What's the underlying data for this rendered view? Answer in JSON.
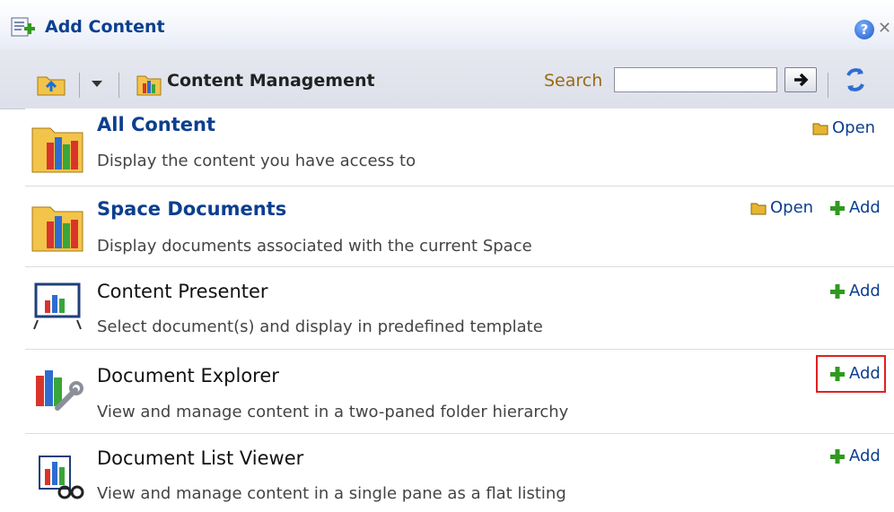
{
  "dialog": {
    "title": "Add Content",
    "help_icon": "help-icon",
    "close_icon": "close-icon"
  },
  "toolbar": {
    "location": "Content Management",
    "search_label": "Search",
    "search_value": "",
    "search_placeholder": ""
  },
  "items": [
    {
      "name": "All Content",
      "description": "Display the content you have access to",
      "icon": "library-folder-icon",
      "actions": [
        "Open"
      ]
    },
    {
      "name": "Space Documents",
      "description": "Display documents associated with the current Space",
      "icon": "library-folder-icon",
      "actions": [
        "Open",
        "Add"
      ]
    },
    {
      "name": "Content Presenter",
      "description": "Select document(s) and display in predefined template",
      "icon": "presentation-board-icon",
      "actions": [
        "Add"
      ]
    },
    {
      "name": "Document Explorer",
      "description": "View and manage content in a two-paned folder hierarchy",
      "icon": "books-wrench-icon",
      "actions": [
        "Add"
      ]
    },
    {
      "name": "Document List Viewer",
      "description": "View and manage content in a single pane as a flat listing",
      "icon": "chart-glasses-icon",
      "actions": [
        "Add"
      ]
    }
  ],
  "labels": {
    "open": "Open",
    "add": "Add"
  },
  "colors": {
    "link": "#0b3f8f",
    "highlight": "#e02020",
    "add_green": "#2f9a1f",
    "open_folder": "#e8b431"
  }
}
